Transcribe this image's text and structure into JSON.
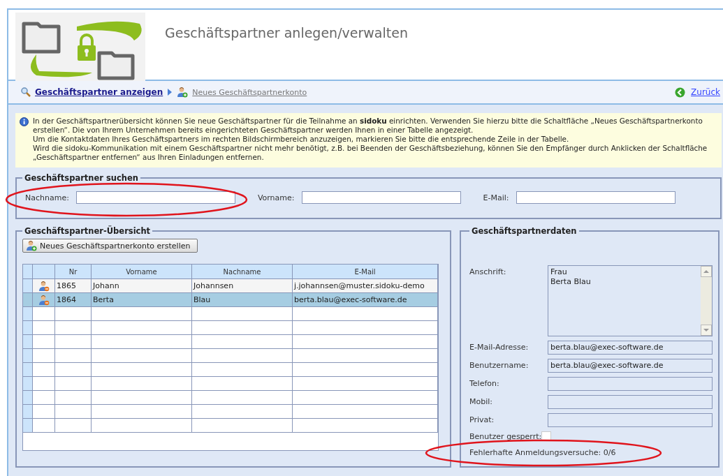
{
  "header": {
    "title": "Geschäftspartner anlegen/verwalten"
  },
  "breadcrumb": {
    "items": [
      {
        "label": "Geschäftspartner anzeigen",
        "selected": true
      },
      {
        "label": "Neues Geschäftspartnerkonto",
        "selected": false
      }
    ],
    "back": "Zurück"
  },
  "info": [
    "In der Geschäftspartnerübersicht können Sie neue Geschäftspartner für die Teilnahme an **sidoku** einrichten. Verwenden Sie hierzu bitte die Schaltfläche „Neues Geschäftspartnerkonto erstellen“. Die von Ihrem Unternehmen bereits eingerichteten Geschäftspartner werden Ihnen in einer Tabelle angezeigt.",
    "Um die Kontaktdaten Ihres Geschäftspartners im rechten Bildschirmbereich anzuzeigen, markieren Sie bitte die entsprechende Zeile in der Tabelle.",
    "Wird die sidoku-Kommunikation mit einem Geschäftspartner nicht mehr benötigt, z.B. bei Beenden der Geschäftsbeziehung, können Sie den Empfänger durch Anklicken der Schaltfläche „Geschäftspartner entfernen“ aus Ihren Einladungen entfernen."
  ],
  "search": {
    "title": "Geschäftspartner suchen",
    "fields": [
      {
        "label": "Nachname:"
      },
      {
        "label": "Vorname:"
      },
      {
        "label": "E-Mail:"
      }
    ]
  },
  "overview": {
    "title": "Geschäftspartner-Übersicht",
    "new_button": "Neues Geschäftspartnerkonto erstellen",
    "table": {
      "columns": [
        "Nr",
        "Vorname",
        "Nachname",
        "E-Mail"
      ],
      "rows": [
        {
          "cells": [
            "1865",
            "Johann",
            "Johannsen",
            "j.johannsen@muster.sidoku-demo"
          ],
          "selected": false
        },
        {
          "cells": [
            "1864",
            "Berta",
            "Blau",
            "berta.blau@exec-software.de"
          ],
          "selected": true
        }
      ]
    }
  },
  "details": {
    "title": "Geschäftspartnerdaten",
    "address": {
      "label": "Anschrift:",
      "lines": [
        "Frau",
        "Berta Blau"
      ]
    },
    "fields": [
      {
        "label": "E-Mail-Adresse:",
        "value": "berta.blau@exec-software.de"
      },
      {
        "label": "Benutzername:",
        "value": "berta.blau@exec-software.de"
      },
      {
        "label": "Telefon:"
      },
      {
        "label": "Mobil:"
      },
      {
        "label": "Privat:"
      }
    ],
    "locked": {
      "label": "Benutzer gesperrt:",
      "checked": false
    },
    "failed_logins": "Fehlerhafte Anmeldungsversuche: 0/6"
  }
}
